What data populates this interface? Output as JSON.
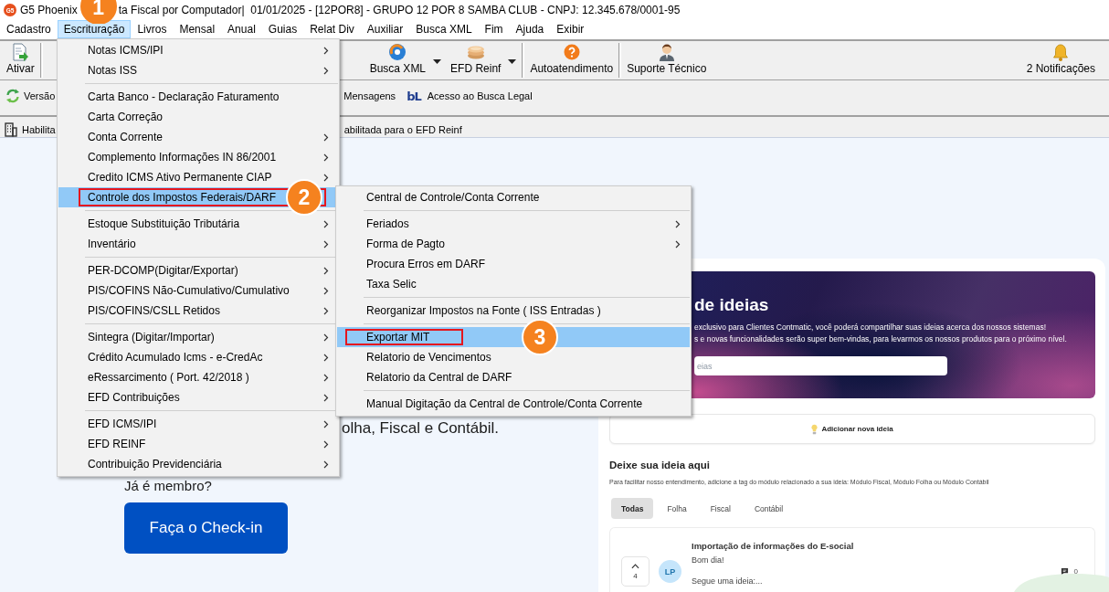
{
  "window": {
    "logo": "G5",
    "title_start": "G5 Phoenix",
    "title_end": "ta Fiscal por Computador|  01/01/2025 - [12POR8] - GRUPO 12 POR 8 SAMBA CLUB - CNPJ: 12.345.678/0001-95"
  },
  "annotations": [
    "1",
    "2",
    "3"
  ],
  "menu_bar": [
    {
      "label": "Cadastro",
      "selected": false
    },
    {
      "label": "Escrituração",
      "selected": true
    },
    {
      "label": "Livros",
      "selected": false
    },
    {
      "label": "Mensal",
      "selected": false
    },
    {
      "label": "Anual",
      "selected": false
    },
    {
      "label": "Guias",
      "selected": false
    },
    {
      "label": "Relat Div",
      "selected": false
    },
    {
      "label": "Auxiliar",
      "selected": false
    },
    {
      "label": "Busca XML",
      "selected": false
    },
    {
      "label": "Fim",
      "selected": false
    },
    {
      "label": "Ajuda",
      "selected": false
    },
    {
      "label": "Exibir",
      "selected": false
    }
  ],
  "toolbar": [
    {
      "label": "Ativar",
      "dropdown": false
    },
    {
      "label": "Busca XML",
      "dropdown": true
    },
    {
      "label": "EFD Reinf",
      "dropdown": true
    },
    {
      "label": "Autoatendimento",
      "dropdown": false
    },
    {
      "label": "Suporte Técnico",
      "dropdown": false
    },
    {
      "label": "2 Notificações",
      "dropdown": false
    }
  ],
  "quick_bar": [
    {
      "label": "Versão"
    },
    {
      "label": "Mensagens"
    },
    {
      "label": "Acesso ao Busca Legal",
      "logo": "bL"
    }
  ],
  "info_bar": [
    "Habilita",
    "abilitada para o EFD Reinf"
  ],
  "escrituracao_menu": {
    "groups": [
      {
        "items": [
          {
            "label": "Notas ICMS/IPI",
            "arrow": true,
            "selected": false,
            "marked": false
          },
          {
            "label": "Notas ISS",
            "arrow": true,
            "selected": false,
            "marked": false
          }
        ]
      },
      {
        "items": [
          {
            "label": "Carta Banco - Declaração Faturamento",
            "arrow": false,
            "selected": false,
            "marked": false
          },
          {
            "label": "Carta Correção",
            "arrow": false,
            "selected": false,
            "marked": false
          },
          {
            "label": "Conta Corrente",
            "arrow": true,
            "selected": false,
            "marked": false
          },
          {
            "label": "Complemento Informações IN 86/2001",
            "arrow": true,
            "selected": false,
            "marked": false
          },
          {
            "label": "Credito ICMS Ativo Permanente CIAP",
            "arrow": true,
            "selected": false,
            "marked": false
          },
          {
            "label": "Controle dos Impostos Federais/DARF",
            "arrow": false,
            "selected": true,
            "marked": true
          }
        ]
      },
      {
        "items": [
          {
            "label": "Estoque Substituição Tributária",
            "arrow": true,
            "selected": false,
            "marked": false
          },
          {
            "label": "Inventário",
            "arrow": true,
            "selected": false,
            "marked": false
          }
        ]
      },
      {
        "items": [
          {
            "label": "PER-DCOMP(Digitar/Exportar)",
            "arrow": true,
            "selected": false,
            "marked": false
          },
          {
            "label": "PIS/COFINS Não-Cumulativo/Cumulativo",
            "arrow": true,
            "selected": false,
            "marked": false
          },
          {
            "label": "PIS/COFINS/CSLL Retidos",
            "arrow": true,
            "selected": false,
            "marked": false
          }
        ]
      },
      {
        "items": [
          {
            "label": "Sintegra (Digitar/Importar)",
            "arrow": true,
            "selected": false,
            "marked": false
          },
          {
            "label": "Crédito Acumulado Icms - e-CredAc",
            "arrow": true,
            "selected": false,
            "marked": false
          },
          {
            "label": "eRessarcimento ( Port. 42/2018 )",
            "arrow": true,
            "selected": false,
            "marked": false
          },
          {
            "label": "EFD Contribuições",
            "arrow": true,
            "selected": false,
            "marked": false
          }
        ]
      },
      {
        "items": [
          {
            "label": "EFD ICMS/IPI",
            "arrow": true,
            "selected": false,
            "marked": false
          },
          {
            "label": "EFD REINF",
            "arrow": true,
            "selected": false,
            "marked": false
          },
          {
            "label": "Contribuição Previdenciária",
            "arrow": true,
            "selected": false,
            "marked": false
          }
        ]
      }
    ]
  },
  "darf_submenu": {
    "groups": [
      {
        "items": [
          {
            "label": "Central de Controle/Conta Corrente",
            "arrow": false,
            "selected": false,
            "marked": false
          }
        ]
      },
      {
        "items": [
          {
            "label": "Feriados",
            "arrow": true,
            "selected": false,
            "marked": false
          },
          {
            "label": "Forma de Pagto",
            "arrow": true,
            "selected": false,
            "marked": false
          },
          {
            "label": "Procura Erros em DARF",
            "arrow": false,
            "selected": false,
            "marked": false
          },
          {
            "label": "Taxa Selic",
            "arrow": false,
            "selected": false,
            "marked": false
          }
        ]
      },
      {
        "items": [
          {
            "label": "Reorganizar Impostos na Fonte ( ISS Entradas )",
            "arrow": false,
            "selected": false,
            "marked": false
          }
        ]
      },
      {
        "items": [
          {
            "label": "Exportar MIT",
            "arrow": false,
            "selected": true,
            "marked": true
          },
          {
            "label": "Relatorio de Vencimentos",
            "arrow": false,
            "selected": false,
            "marked": false
          },
          {
            "label": "Relatorio da Central de DARF",
            "arrow": false,
            "selected": false,
            "marked": false
          }
        ]
      },
      {
        "items": [
          {
            "label": "Manual Digitação da Central de Controle/Conta Corrente",
            "arrow": false,
            "selected": false,
            "marked": false
          }
        ]
      }
    ]
  },
  "page": {
    "tagline": "olha, Fiscal e Contábil.",
    "member_prompt": "Já é membro?",
    "checkin_button": "Faça o Check-in"
  },
  "ideas": {
    "banner": {
      "title": "de ideias",
      "lines": [
        "exclusivo para Clientes Contmatic, você poderá compartilhar suas ideias acerca dos nossos sistemas!",
        "s e novas funcionalidades serão super bem-vindas, para levarmos os nossos produtos para o próximo nível."
      ],
      "search_placeholder": "eias"
    },
    "add_button": "Adicionar nova ideia",
    "heading": "Deixe sua ideia aqui",
    "hint": "Para facilitar nosso entendimento, adicione a tag do módulo relacionado a sua ideia: Módulo Fiscal, Módulo Folha ou Módulo Contábil",
    "tabs": [
      {
        "label": "Todas",
        "selected": true
      },
      {
        "label": "Folha",
        "selected": false
      },
      {
        "label": "Fiscal",
        "selected": false
      },
      {
        "label": "Contábil",
        "selected": false
      }
    ],
    "posts": [
      {
        "title": "Importação de informações do E-social",
        "votes": "4",
        "initials": "LP",
        "lines": [
          "Bom dia!",
          "Segue uma ideia:..."
        ],
        "comments": "0"
      }
    ]
  }
}
